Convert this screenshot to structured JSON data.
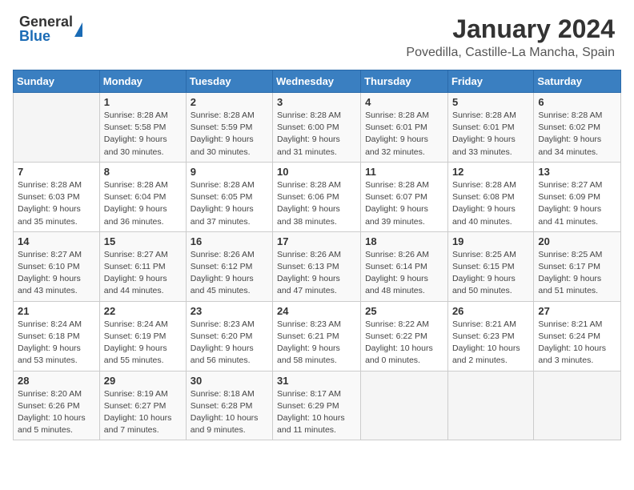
{
  "header": {
    "logo_general": "General",
    "logo_blue": "Blue",
    "month_year": "January 2024",
    "location": "Povedilla, Castille-La Mancha, Spain"
  },
  "days_of_week": [
    "Sunday",
    "Monday",
    "Tuesday",
    "Wednesday",
    "Thursday",
    "Friday",
    "Saturday"
  ],
  "weeks": [
    [
      {
        "day": "",
        "info": ""
      },
      {
        "day": "1",
        "info": "Sunrise: 8:28 AM\nSunset: 5:58 PM\nDaylight: 9 hours\nand 30 minutes."
      },
      {
        "day": "2",
        "info": "Sunrise: 8:28 AM\nSunset: 5:59 PM\nDaylight: 9 hours\nand 30 minutes."
      },
      {
        "day": "3",
        "info": "Sunrise: 8:28 AM\nSunset: 6:00 PM\nDaylight: 9 hours\nand 31 minutes."
      },
      {
        "day": "4",
        "info": "Sunrise: 8:28 AM\nSunset: 6:01 PM\nDaylight: 9 hours\nand 32 minutes."
      },
      {
        "day": "5",
        "info": "Sunrise: 8:28 AM\nSunset: 6:01 PM\nDaylight: 9 hours\nand 33 minutes."
      },
      {
        "day": "6",
        "info": "Sunrise: 8:28 AM\nSunset: 6:02 PM\nDaylight: 9 hours\nand 34 minutes."
      }
    ],
    [
      {
        "day": "7",
        "info": "Sunrise: 8:28 AM\nSunset: 6:03 PM\nDaylight: 9 hours\nand 35 minutes."
      },
      {
        "day": "8",
        "info": "Sunrise: 8:28 AM\nSunset: 6:04 PM\nDaylight: 9 hours\nand 36 minutes."
      },
      {
        "day": "9",
        "info": "Sunrise: 8:28 AM\nSunset: 6:05 PM\nDaylight: 9 hours\nand 37 minutes."
      },
      {
        "day": "10",
        "info": "Sunrise: 8:28 AM\nSunset: 6:06 PM\nDaylight: 9 hours\nand 38 minutes."
      },
      {
        "day": "11",
        "info": "Sunrise: 8:28 AM\nSunset: 6:07 PM\nDaylight: 9 hours\nand 39 minutes."
      },
      {
        "day": "12",
        "info": "Sunrise: 8:28 AM\nSunset: 6:08 PM\nDaylight: 9 hours\nand 40 minutes."
      },
      {
        "day": "13",
        "info": "Sunrise: 8:27 AM\nSunset: 6:09 PM\nDaylight: 9 hours\nand 41 minutes."
      }
    ],
    [
      {
        "day": "14",
        "info": "Sunrise: 8:27 AM\nSunset: 6:10 PM\nDaylight: 9 hours\nand 43 minutes."
      },
      {
        "day": "15",
        "info": "Sunrise: 8:27 AM\nSunset: 6:11 PM\nDaylight: 9 hours\nand 44 minutes."
      },
      {
        "day": "16",
        "info": "Sunrise: 8:26 AM\nSunset: 6:12 PM\nDaylight: 9 hours\nand 45 minutes."
      },
      {
        "day": "17",
        "info": "Sunrise: 8:26 AM\nSunset: 6:13 PM\nDaylight: 9 hours\nand 47 minutes."
      },
      {
        "day": "18",
        "info": "Sunrise: 8:26 AM\nSunset: 6:14 PM\nDaylight: 9 hours\nand 48 minutes."
      },
      {
        "day": "19",
        "info": "Sunrise: 8:25 AM\nSunset: 6:15 PM\nDaylight: 9 hours\nand 50 minutes."
      },
      {
        "day": "20",
        "info": "Sunrise: 8:25 AM\nSunset: 6:17 PM\nDaylight: 9 hours\nand 51 minutes."
      }
    ],
    [
      {
        "day": "21",
        "info": "Sunrise: 8:24 AM\nSunset: 6:18 PM\nDaylight: 9 hours\nand 53 minutes."
      },
      {
        "day": "22",
        "info": "Sunrise: 8:24 AM\nSunset: 6:19 PM\nDaylight: 9 hours\nand 55 minutes."
      },
      {
        "day": "23",
        "info": "Sunrise: 8:23 AM\nSunset: 6:20 PM\nDaylight: 9 hours\nand 56 minutes."
      },
      {
        "day": "24",
        "info": "Sunrise: 8:23 AM\nSunset: 6:21 PM\nDaylight: 9 hours\nand 58 minutes."
      },
      {
        "day": "25",
        "info": "Sunrise: 8:22 AM\nSunset: 6:22 PM\nDaylight: 10 hours\nand 0 minutes."
      },
      {
        "day": "26",
        "info": "Sunrise: 8:21 AM\nSunset: 6:23 PM\nDaylight: 10 hours\nand 2 minutes."
      },
      {
        "day": "27",
        "info": "Sunrise: 8:21 AM\nSunset: 6:24 PM\nDaylight: 10 hours\nand 3 minutes."
      }
    ],
    [
      {
        "day": "28",
        "info": "Sunrise: 8:20 AM\nSunset: 6:26 PM\nDaylight: 10 hours\nand 5 minutes."
      },
      {
        "day": "29",
        "info": "Sunrise: 8:19 AM\nSunset: 6:27 PM\nDaylight: 10 hours\nand 7 minutes."
      },
      {
        "day": "30",
        "info": "Sunrise: 8:18 AM\nSunset: 6:28 PM\nDaylight: 10 hours\nand 9 minutes."
      },
      {
        "day": "31",
        "info": "Sunrise: 8:17 AM\nSunset: 6:29 PM\nDaylight: 10 hours\nand 11 minutes."
      },
      {
        "day": "",
        "info": ""
      },
      {
        "day": "",
        "info": ""
      },
      {
        "day": "",
        "info": ""
      }
    ]
  ]
}
